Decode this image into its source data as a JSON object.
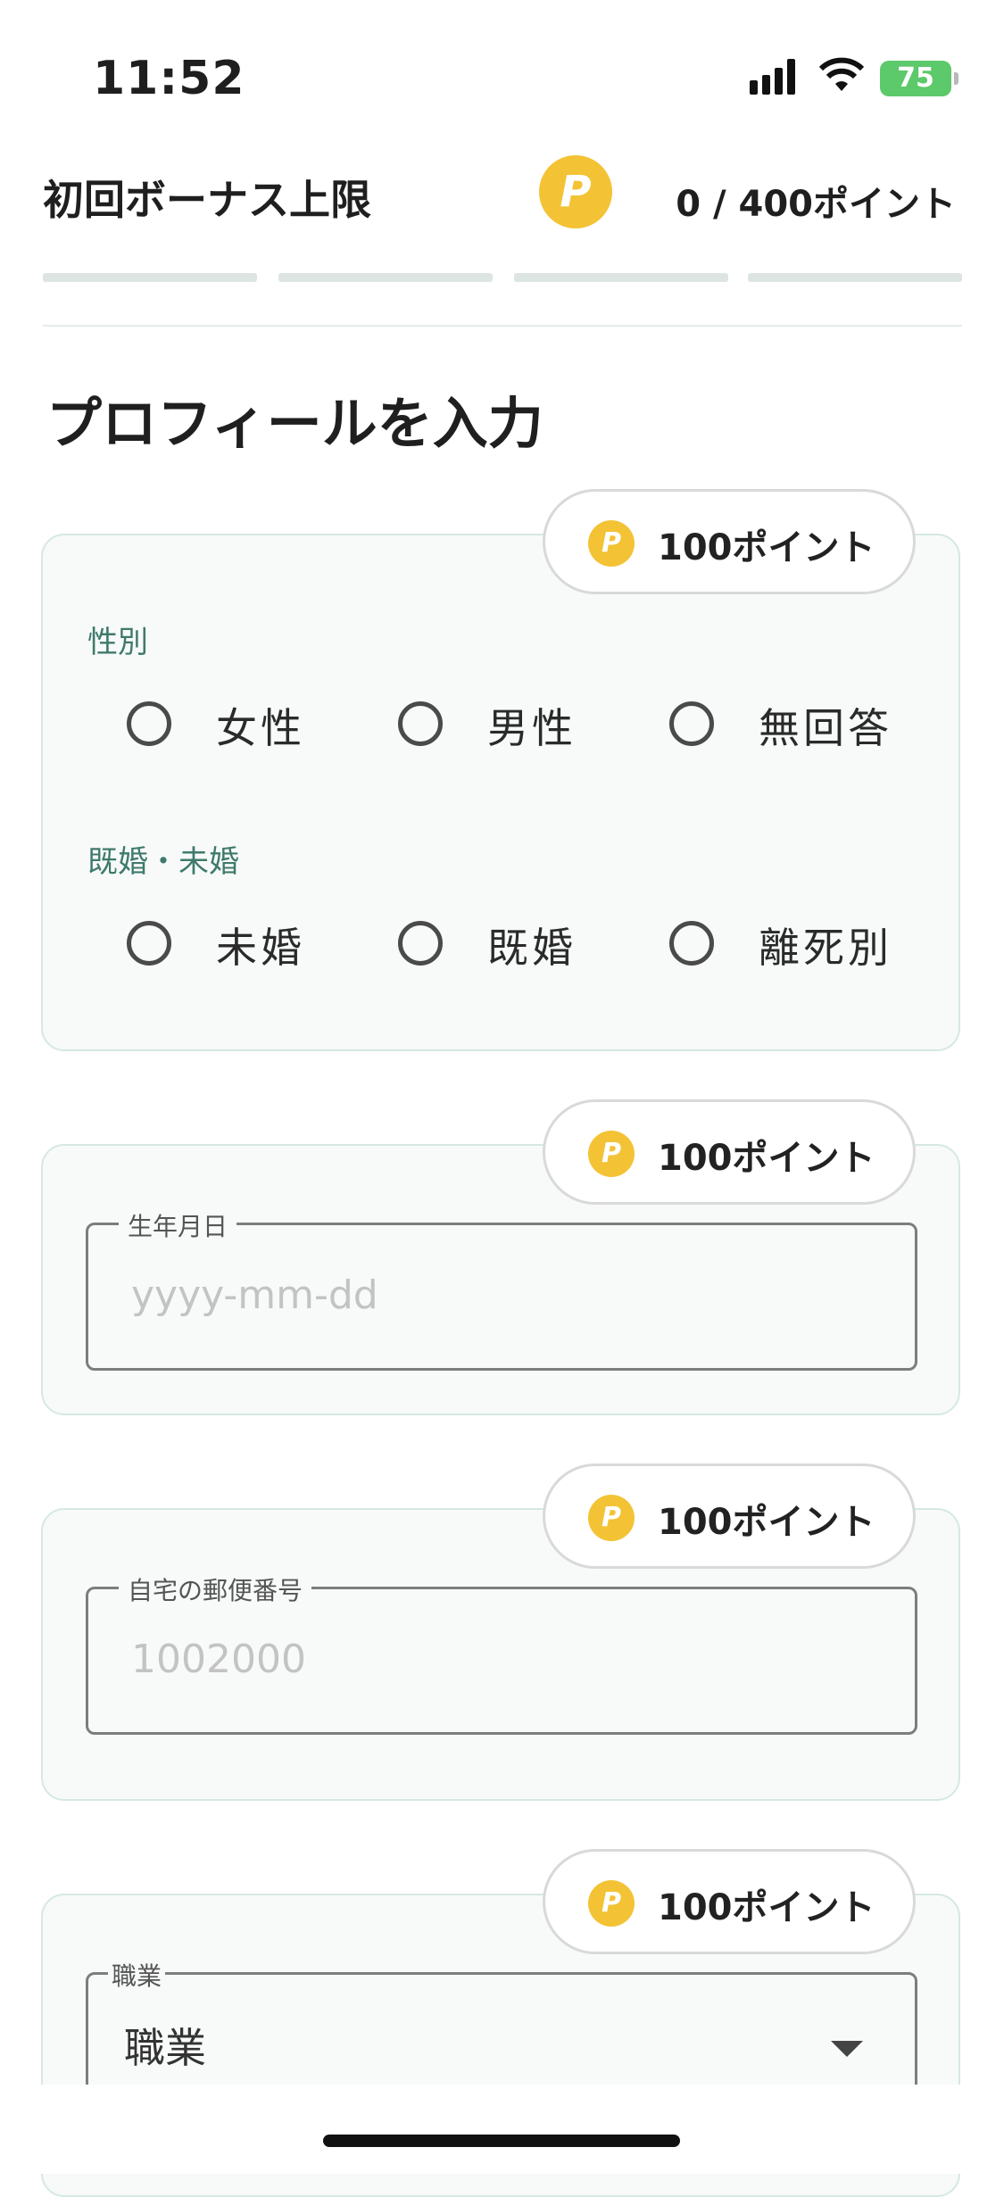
{
  "status_bar": {
    "time": "11:52",
    "battery": "75"
  },
  "header": {
    "bonus_title": "初回ボーナス上限",
    "coin_symbol": "P",
    "points": "0 / 400ポイント"
  },
  "page_title": "プロフィールを入力",
  "point_badge": "100ポイント",
  "gender": {
    "label": "性別",
    "options": [
      "女性",
      "男性",
      "無回答"
    ]
  },
  "marital": {
    "label": "既婚・未婚",
    "options": [
      "未婚",
      "既婚",
      "離死別"
    ]
  },
  "birthday": {
    "label": "生年月日",
    "placeholder": "yyyy-mm-dd"
  },
  "postal": {
    "label": "自宅の郵便番号",
    "placeholder": "1002000"
  },
  "occupation": {
    "label": "職業",
    "value": "職業"
  }
}
